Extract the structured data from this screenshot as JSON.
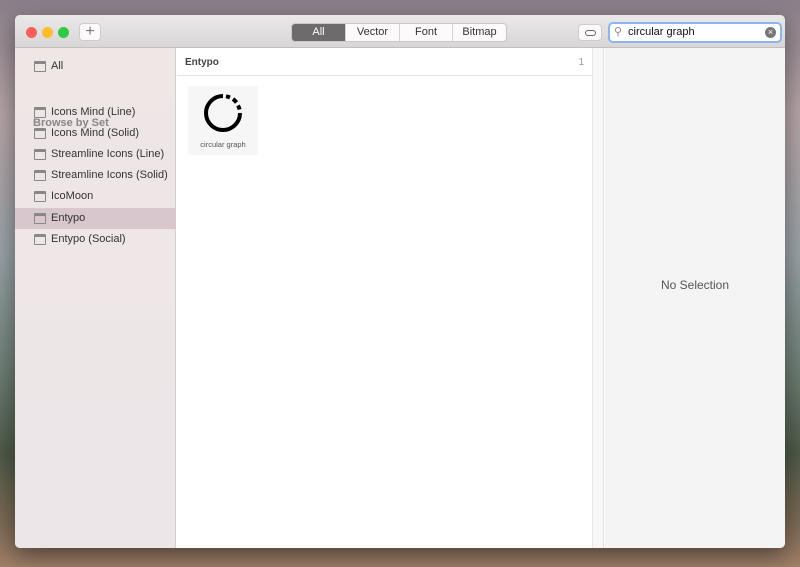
{
  "toolbar": {
    "add_label": "+",
    "filters": [
      "All",
      "Vector",
      "Font",
      "Bitmap"
    ],
    "active_filter": "All",
    "search_value": "circular graph"
  },
  "sidebar": {
    "all_label": "All",
    "section_title": "Browse by Set",
    "items": [
      "Icons Mind (Line)",
      "Icons Mind (Solid)",
      "Streamline Icons (Line)",
      "Streamline Icons (Solid)",
      "IcoMoon",
      "Entypo",
      "Entypo (Social)"
    ],
    "selected": "Entypo"
  },
  "main": {
    "group_title": "Entypo",
    "group_count": "1",
    "icons": [
      {
        "name": "circular graph"
      }
    ]
  },
  "detail": {
    "empty_text": "No Selection"
  }
}
